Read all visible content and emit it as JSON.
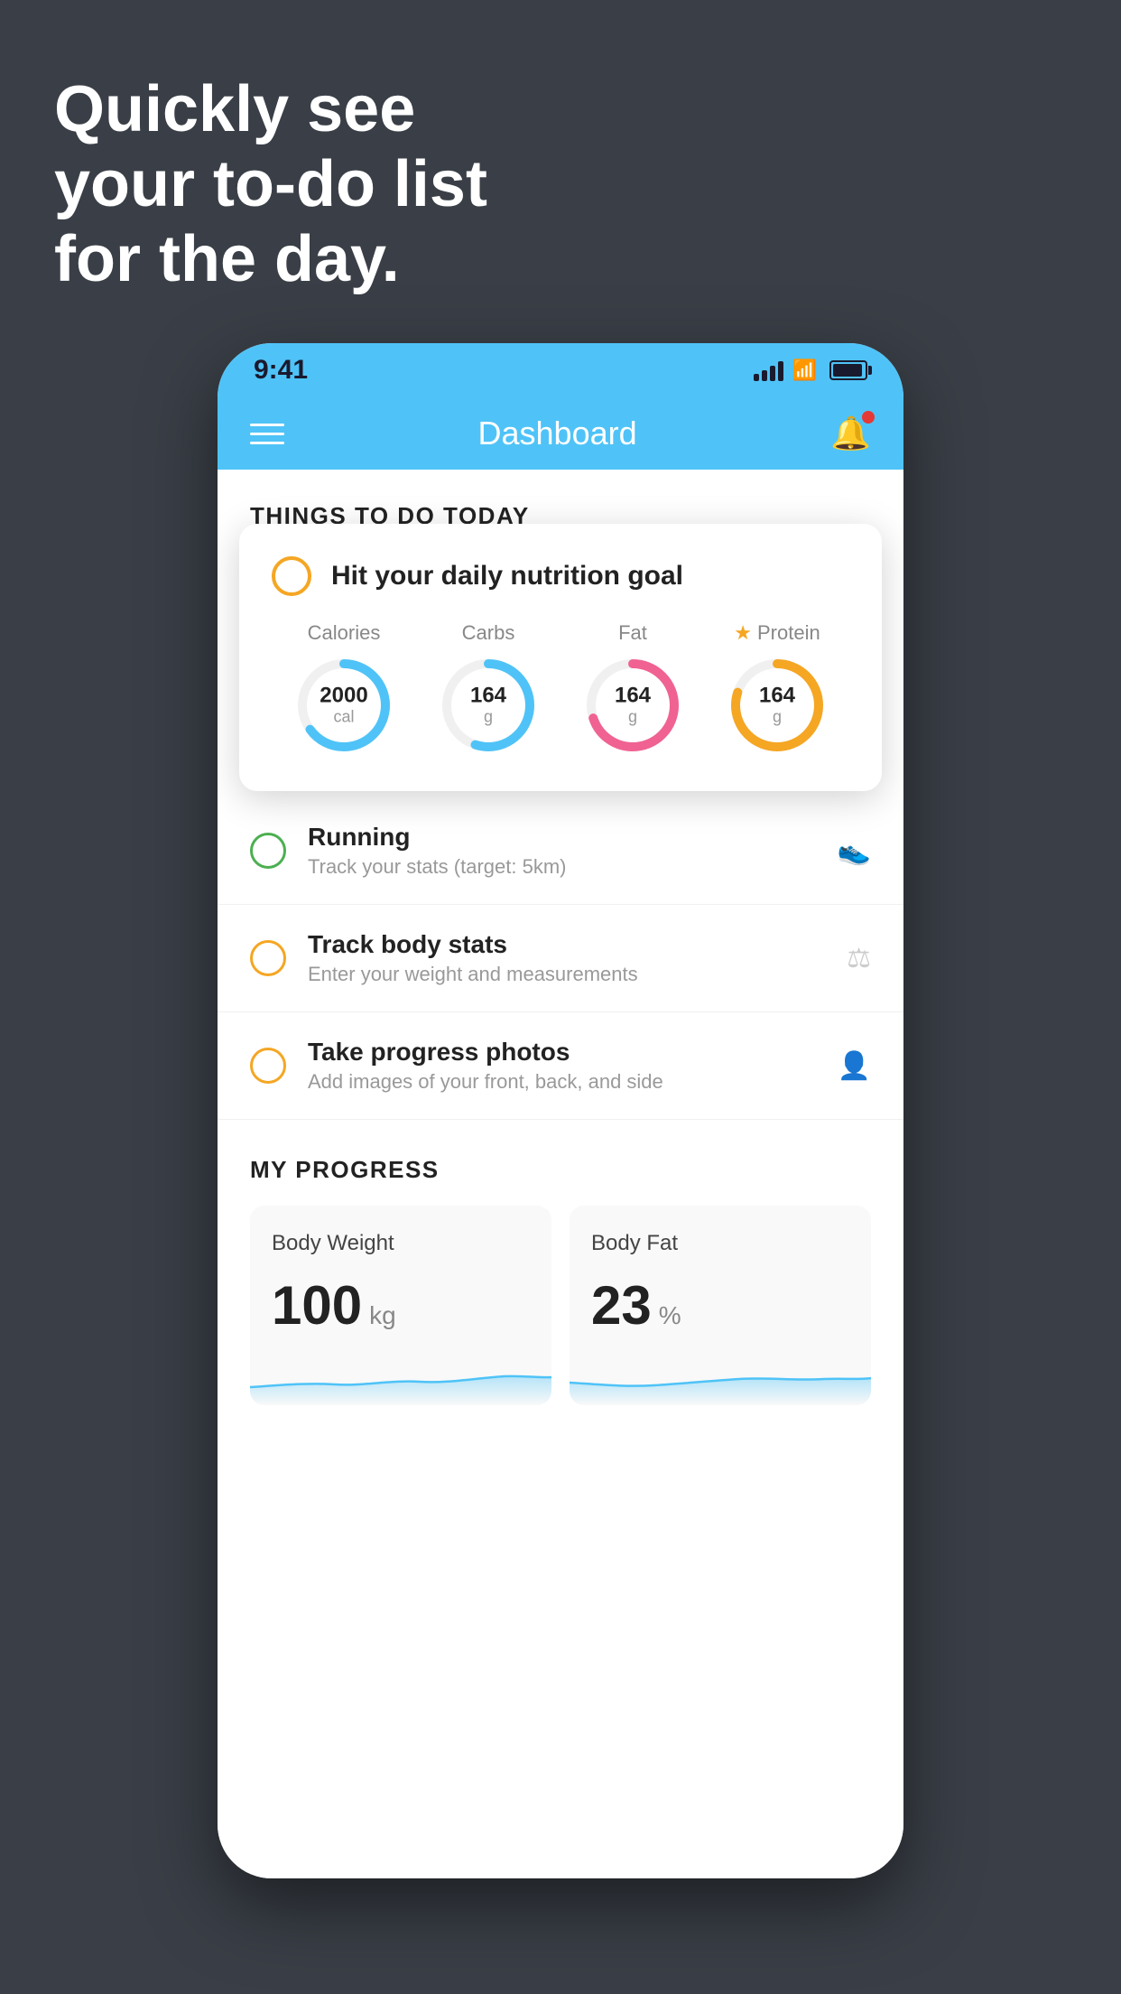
{
  "hero": {
    "line1": "Quickly see",
    "line2": "your to-do list",
    "line3": "for the day."
  },
  "status_bar": {
    "time": "9:41"
  },
  "nav": {
    "title": "Dashboard"
  },
  "things_section": {
    "label": "THINGS TO DO TODAY"
  },
  "nutrition_card": {
    "title": "Hit your daily nutrition goal",
    "items": [
      {
        "label": "Calories",
        "value": "2000",
        "unit": "cal",
        "color": "#4fc3f7",
        "percent": 65
      },
      {
        "label": "Carbs",
        "value": "164",
        "unit": "g",
        "color": "#4fc3f7",
        "percent": 55
      },
      {
        "label": "Fat",
        "value": "164",
        "unit": "g",
        "color": "#f06292",
        "percent": 70
      },
      {
        "label": "Protein",
        "value": "164",
        "unit": "g",
        "color": "#f5a623",
        "percent": 80,
        "star": true
      }
    ]
  },
  "todo_items": [
    {
      "title": "Running",
      "subtitle": "Track your stats (target: 5km)",
      "circle_color": "green",
      "icon": "👟"
    },
    {
      "title": "Track body stats",
      "subtitle": "Enter your weight and measurements",
      "circle_color": "yellow",
      "icon": "⚖️"
    },
    {
      "title": "Take progress photos",
      "subtitle": "Add images of your front, back, and side",
      "circle_color": "yellow",
      "icon": "👤"
    }
  ],
  "progress_section": {
    "label": "MY PROGRESS",
    "cards": [
      {
        "title": "Body Weight",
        "value": "100",
        "unit": "kg"
      },
      {
        "title": "Body Fat",
        "value": "23",
        "unit": "%"
      }
    ]
  }
}
